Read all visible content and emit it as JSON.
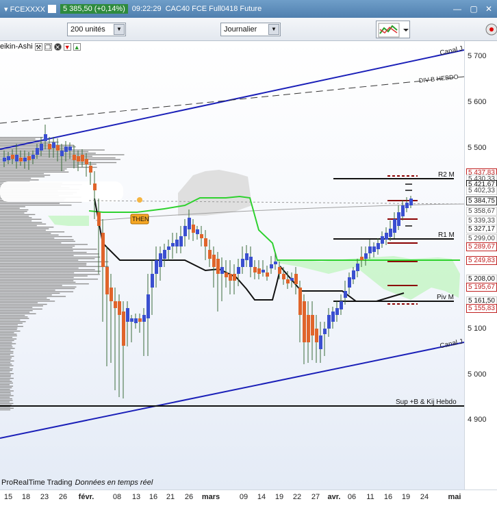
{
  "titlebar": {
    "symbol": "FCEXXXX",
    "price": "5 385,50 (+0,14%)",
    "time": "09:22:29",
    "instrument": "CAC40 FCE Full0418 Future"
  },
  "toolbar": {
    "units_value": "200 unités",
    "period_value": "Journalier"
  },
  "indicator_label": "eikin-Ashi",
  "footer": {
    "brand": "ProRealTime Trading",
    "realtime": "Données en temps réel"
  },
  "y_ticks": [
    "5 700",
    "5 600",
    "5 500",
    "5 100",
    "5 000",
    "4 900"
  ],
  "price_labels": [
    "5 437,83",
    "5 430,33",
    "5 421,67",
    "5 402,33",
    "5 384,75",
    "5 358,67",
    "5 339,33",
    "5 327,17",
    "5 299,00",
    "5 289,67",
    "5 249,83",
    "5 208,00",
    "5 195,67",
    "5 161,50",
    "5 155,83"
  ],
  "x_ticks": [
    "15",
    "18",
    "23",
    "26",
    "févr.",
    "08",
    "13",
    "16",
    "21",
    "26",
    "mars",
    "09",
    "14",
    "19",
    "22",
    "27",
    "avr.",
    "06",
    "11",
    "16",
    "19",
    "24",
    "mai"
  ],
  "annotations": {
    "canal_top": "Canal J",
    "div_b": "DIV B HEBDO",
    "r2": "R2 M",
    "r1": "R1 M",
    "piv": "Piv M",
    "canal_bottom": "Canal J",
    "sup": "Sup +B  & Kij Hebdo",
    "then": "THEN"
  },
  "colors": {
    "up": "#3a4fd0",
    "down": "#e0642a",
    "channel": "#1a1fb8",
    "kijun": "#2ed12e",
    "cloud": "#c9f5c9"
  }
}
